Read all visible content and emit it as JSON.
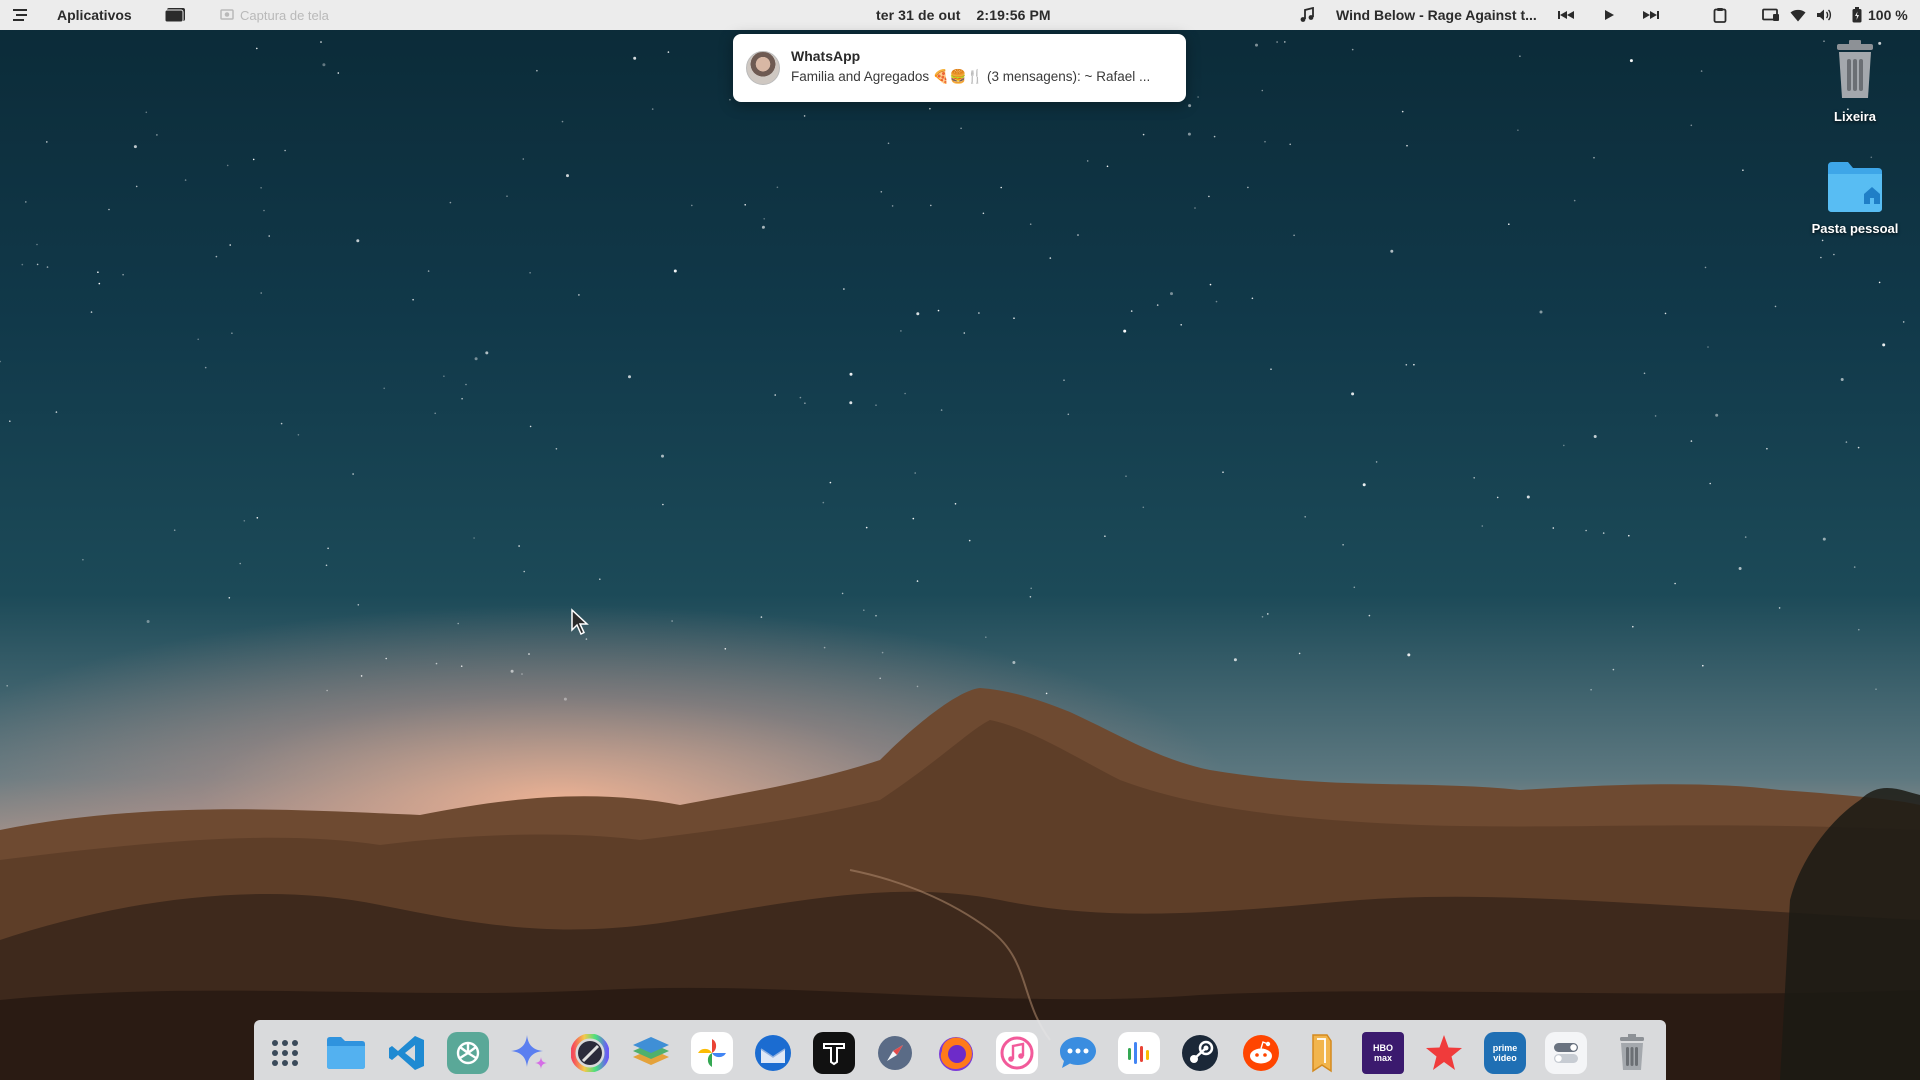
{
  "topbar": {
    "menu_icon": "menu-icon",
    "apps_label": "Aplicativos",
    "window_icon": "window-icon",
    "screenshot_label": "Captura de tela",
    "date": "ter 31 de out",
    "time": "2:19:56 PM",
    "music_icon": "music-note-icon",
    "now_playing": "Wind Below - Rage Against t...",
    "battery": "100 %"
  },
  "notification": {
    "app": "WhatsApp",
    "body": "Familia and Agregados 🍕🍔🍴 (3 mensagens): ~ Rafael ..."
  },
  "desktop": {
    "trash_label": "Lixeira",
    "home_label": "Pasta pessoal"
  },
  "dock": {
    "apps": [
      {
        "name": "app-grid-icon"
      },
      {
        "name": "files-icon"
      },
      {
        "name": "vscode-icon"
      },
      {
        "name": "chatgpt-icon"
      },
      {
        "name": "gemini-icon"
      },
      {
        "name": "color-picker-icon"
      },
      {
        "name": "layers-icon"
      },
      {
        "name": "google-photos-icon"
      },
      {
        "name": "thunderbird-icon"
      },
      {
        "name": "typora-icon"
      },
      {
        "name": "safari-compass-icon"
      },
      {
        "name": "firefox-icon"
      },
      {
        "name": "music-icon",
        "running": true
      },
      {
        "name": "messages-icon"
      },
      {
        "name": "equalizer-icon"
      },
      {
        "name": "steam-icon"
      },
      {
        "name": "reddit-icon"
      },
      {
        "name": "bookmark-icon"
      },
      {
        "name": "hbo-max-icon"
      },
      {
        "name": "starred-icon"
      },
      {
        "name": "prime-video-icon"
      },
      {
        "name": "toggle-settings-icon"
      },
      {
        "name": "trash-icon"
      }
    ],
    "hbo_label": "HBO max",
    "prime_label": "prime video"
  },
  "colors": {
    "topbar_bg": "#ececec",
    "dock_bg": "#e8eaee",
    "accent_blue": "#3c8bd9"
  }
}
